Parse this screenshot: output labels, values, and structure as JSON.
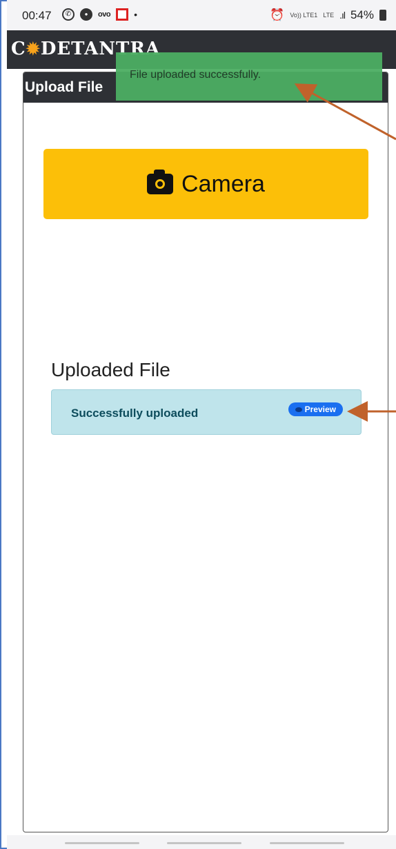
{
  "status_bar": {
    "time": "00:47",
    "ovo": "ovo",
    "dot": "•",
    "volte": "Vo)) LTE1",
    "lte": "LTE",
    "bars": ".ıl",
    "battery": "54%"
  },
  "header": {
    "logo_left": "C",
    "logo_right": "DETANTRA"
  },
  "card": {
    "title": "Upload File",
    "camera_label": "Camera",
    "uploaded_title": "Uploaded File",
    "file_status": "Successfully uploaded",
    "preview_label": "Preview"
  },
  "toast": {
    "message": "File uploaded successfully."
  },
  "colors": {
    "header": "#2e3035",
    "camera": "#fcbf08",
    "toast": "#4cae63",
    "file_row": "#bfe4eb",
    "badge": "#1a6ff0",
    "arrow": "#c0622b"
  }
}
